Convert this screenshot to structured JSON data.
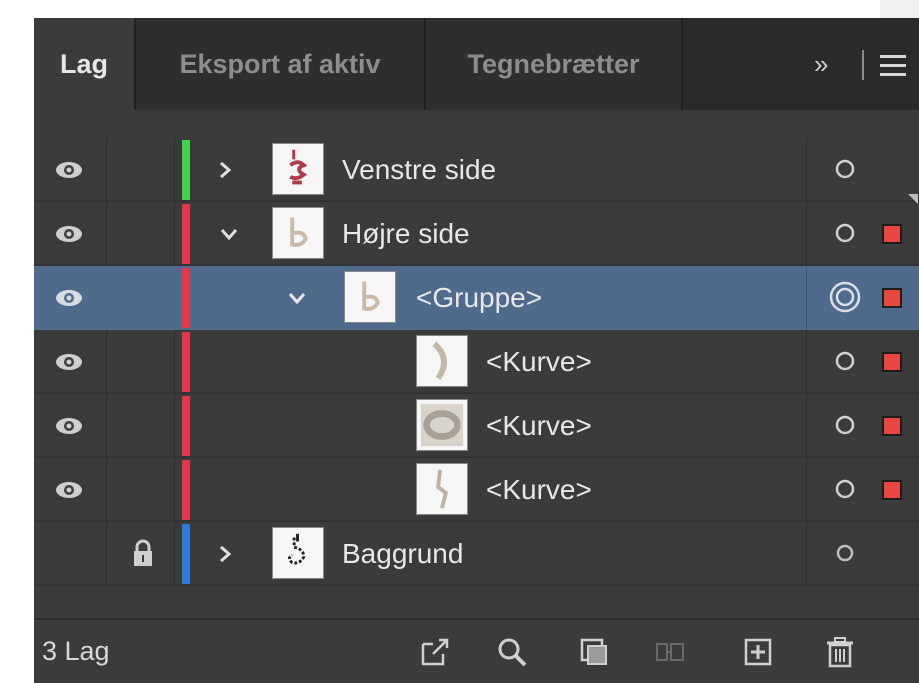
{
  "tabs": [
    {
      "label": "Lag",
      "active": true
    },
    {
      "label": "Eksport af aktiv",
      "active": false
    },
    {
      "label": "Tegnebrætter",
      "active": false
    }
  ],
  "tabbar_right": {
    "overflow_label": "»",
    "menu_icon": "hamburger-menu-icon"
  },
  "layers": [
    {
      "label": "Venstre side",
      "color": "#3fd34a",
      "expanded": false,
      "level": 0,
      "selected": false,
      "has_selection_square": false,
      "thumb": "red-glyph-thumbnail"
    },
    {
      "label": "Højre side",
      "color": "#e3384b",
      "expanded": true,
      "level": 0,
      "selected": false,
      "has_selection_square": true,
      "thumb": "curve-b-thumbnail"
    },
    {
      "label": "<Gruppe>",
      "color": "#e3384b",
      "expanded": true,
      "level": 1,
      "selected": true,
      "has_selection_square": true,
      "thumb": "curve-b-thumbnail"
    },
    {
      "label": "<Kurve>",
      "color": "#e3384b",
      "level": 2,
      "selected": false,
      "has_selection_square": true,
      "thumb": "arc-thumbnail"
    },
    {
      "label": "<Kurve>",
      "color": "#e3384b",
      "level": 2,
      "selected": false,
      "has_selection_square": true,
      "thumb": "ring-thumbnail"
    },
    {
      "label": "<Kurve>",
      "color": "#e3384b",
      "level": 2,
      "selected": false,
      "has_selection_square": true,
      "thumb": "stroke-thumbnail"
    },
    {
      "label": "Baggrund",
      "color": "#2f7bdc",
      "expanded": false,
      "level": 0,
      "locked": true,
      "selected": false,
      "has_selection_square": false,
      "thumb": "dotted-figure-thumbnail"
    }
  ],
  "footer": {
    "count_label": "3 Lag",
    "icons": [
      "export-icon",
      "search-icon",
      "clipping-mask-icon",
      "collect-for-export-icon",
      "new-layer-icon",
      "trash-icon"
    ]
  },
  "colors": {
    "panel": "#3b3b3b",
    "selected_row": "#4f6a8a",
    "selection_square": "#e8483f"
  }
}
